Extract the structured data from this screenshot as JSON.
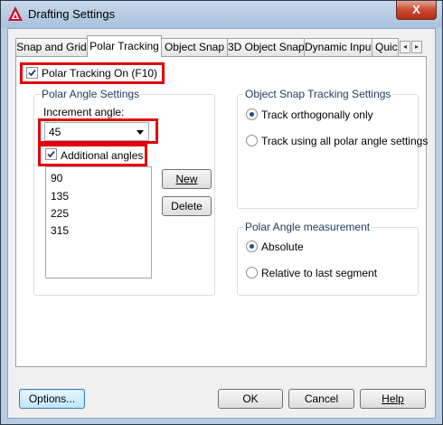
{
  "window": {
    "title": "Drafting Settings",
    "close_label": "X",
    "icon": "autocad-a-icon",
    "accent_color": "#e2000f"
  },
  "tabs": [
    {
      "label": "Snap and Grid",
      "active": false
    },
    {
      "label": "Polar Tracking",
      "active": true
    },
    {
      "label": "Object Snap",
      "active": false
    },
    {
      "label": "3D Object Snap",
      "active": false
    },
    {
      "label": "Dynamic Input",
      "active": false
    },
    {
      "label": "Quic",
      "active": false
    }
  ],
  "tab_scroll": {
    "left": "◂",
    "right": "▸"
  },
  "polar_tracking_on": {
    "label": "Polar Tracking On (F10)",
    "checked": true
  },
  "polar_angle_settings": {
    "title": "Polar Angle Settings",
    "increment_label": "Increment angle:",
    "increment_value": "45",
    "additional_angles": {
      "label": "Additional angles",
      "checked": true
    },
    "angles": [
      "90",
      "135",
      "225",
      "315"
    ],
    "new_button": "New",
    "delete_button": "Delete"
  },
  "object_snap_tracking": {
    "title": "Object Snap Tracking Settings",
    "options": [
      {
        "label": "Track orthogonally only",
        "selected": true
      },
      {
        "label": "Track using all polar angle settings",
        "selected": false
      }
    ]
  },
  "polar_angle_measurement": {
    "title": "Polar Angle measurement",
    "options": [
      {
        "label": "Absolute",
        "selected": true
      },
      {
        "label": "Relative to last segment",
        "selected": false
      }
    ]
  },
  "footer": {
    "options_button": "Options...",
    "ok_button": "OK",
    "cancel_button": "Cancel",
    "help_button": "Help"
  }
}
